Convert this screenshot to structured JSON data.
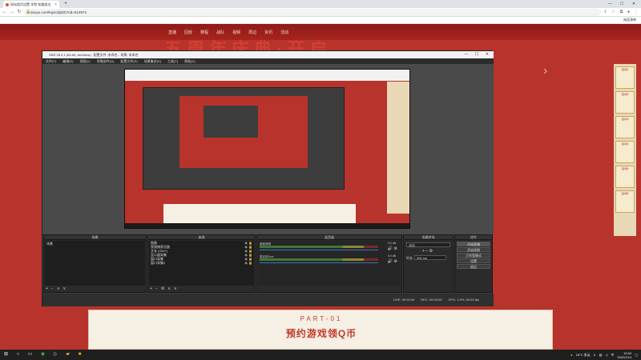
{
  "browser": {
    "tab_title": "网站首页设置 学院·知路组址",
    "tab_close": "×",
    "new_tab": "+",
    "url": "douyu.com/topic/djdzb?rid=514974",
    "reading_list": "阅读清单",
    "back": "←",
    "forward": "→",
    "reload": "↻",
    "window_minimize": "—",
    "window_maximize": "☐",
    "window_close": "✕"
  },
  "webpage": {
    "nav_items": [
      "直播",
      "回放",
      "赛程",
      "战队",
      "视频",
      "周边",
      "资讯",
      "活动"
    ],
    "banner_text": "五周年庆典·开启",
    "side_cards": [
      "活动1",
      "活动2",
      "活动3",
      "活动4",
      "活动5",
      "活动6"
    ],
    "part_label": "PART-01",
    "part_title": "预约游戏领Q币",
    "arrow": "›"
  },
  "obs": {
    "title": "OBS 28.0.1 (64-bit, windows) - 配置文件: 未命名 - 场景: 未命名",
    "menu": [
      "文件(F)",
      "编辑(E)",
      "视图(V)",
      "停靠部件(D)",
      "配置文件(P)",
      "场景集合(S)",
      "工具(T)",
      "帮助(H)"
    ],
    "scenes_header": "场景",
    "scenes": [
      "场景"
    ],
    "sources_header": "来源",
    "sources": [
      "图像",
      "视频捕获设备",
      "文本 (GDI+)",
      "显示器采集",
      "窗口采集",
      "窗口采集2"
    ],
    "mixer_header": "混音器",
    "mixer_channels": [
      {
        "name": "桌面音频",
        "db": "0.0 dB"
      },
      {
        "name": "麦克风/Aux",
        "db": "0.0 dB"
      }
    ],
    "transitions_header": "场景转场",
    "transition_name": "淡出",
    "transition_duration_label": "时长",
    "transition_duration": "300 ms",
    "controls_header": "控件",
    "controls": [
      "开始直播",
      "开始录制",
      "工作室模式",
      "设置",
      "退出"
    ],
    "status": {
      "live_label": "LIVE:",
      "live_time": "00:00:00",
      "rec_label": "REC:",
      "rec_time": "00:00:00",
      "cpu": "CPU: 1.9%, 60.00 fps"
    },
    "footer_add": "+",
    "footer_remove": "−",
    "footer_up": "∧",
    "footer_down": "∨"
  },
  "taskbar": {
    "weather": "18°C 多云",
    "time": "19:00",
    "date": "2022/2/14",
    "lang": "中"
  }
}
